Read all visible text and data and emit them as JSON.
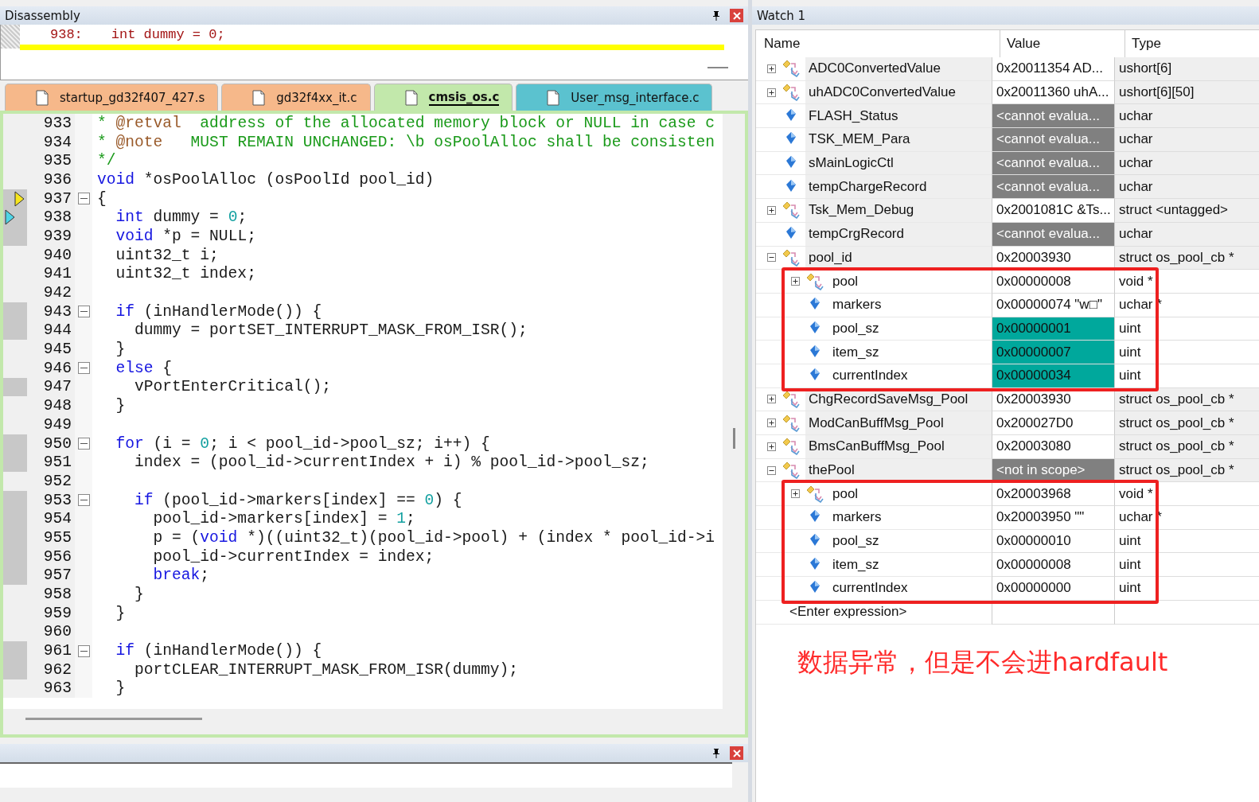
{
  "disassembly": {
    "title": "Disassembly",
    "line_number": "938:",
    "code": "int dummy = 0;"
  },
  "editor": {
    "tabs": [
      {
        "label": "startup_gd32f407_427.s",
        "selected": false,
        "color": "#f6b88a"
      },
      {
        "label": "gd32f4xx_it.c",
        "selected": false,
        "color": "#f6b88a"
      },
      {
        "label": "cmsis_os.c",
        "selected": true,
        "color": "#c2e8ab"
      },
      {
        "label": "User_msg_interface.c",
        "selected": false,
        "color": "#5bc2cf"
      }
    ],
    "lines": [
      {
        "number": "933",
        "kind": "plain",
        "covered": false,
        "foldable": false,
        "segments": [
          {
            "kind": "comment",
            "text": "* "
          },
          {
            "kind": "doc_tag",
            "text": "@retval"
          },
          {
            "kind": "comment",
            "text": "  address of the allocated memory block or NULL in case c"
          }
        ]
      },
      {
        "number": "934",
        "kind": "plain",
        "covered": false,
        "foldable": false,
        "segments": [
          {
            "kind": "comment",
            "text": "* "
          },
          {
            "kind": "doc_tag",
            "text": "@note"
          },
          {
            "kind": "comment",
            "text": "   MUST REMAIN UNCHANGED: \\b osPoolAlloc shall be consisten"
          }
        ]
      },
      {
        "number": "935",
        "kind": "plain",
        "covered": false,
        "foldable": false,
        "segments": [
          {
            "kind": "comment",
            "text": "*/"
          }
        ]
      },
      {
        "number": "936",
        "kind": "plain",
        "covered": false,
        "foldable": false,
        "segments": [
          {
            "kind": "keyword",
            "text": "void"
          },
          {
            "kind": "plain",
            "text": " *osPoolAlloc (osPoolId pool_id)"
          }
        ]
      },
      {
        "number": "937",
        "kind": "current",
        "covered": true,
        "foldable": true,
        "segments": [
          {
            "kind": "plain",
            "text": "{"
          }
        ]
      },
      {
        "number": "938",
        "kind": "caller",
        "covered": true,
        "foldable": false,
        "segments": [
          {
            "kind": "keyword",
            "text": "  int"
          },
          {
            "kind": "plain",
            "text": " dummy = "
          },
          {
            "kind": "number",
            "text": "0"
          },
          {
            "kind": "plain",
            "text": ";"
          }
        ]
      },
      {
        "number": "939",
        "kind": "plain",
        "covered": true,
        "foldable": false,
        "segments": [
          {
            "kind": "keyword",
            "text": "  void"
          },
          {
            "kind": "plain",
            "text": " *p = NULL;"
          }
        ]
      },
      {
        "number": "940",
        "kind": "plain",
        "covered": false,
        "foldable": false,
        "segments": [
          {
            "kind": "plain",
            "text": "  uint32_t i;"
          }
        ]
      },
      {
        "number": "941",
        "kind": "plain",
        "covered": false,
        "foldable": false,
        "segments": [
          {
            "kind": "plain",
            "text": "  uint32_t index;"
          }
        ]
      },
      {
        "number": "942",
        "kind": "plain",
        "covered": false,
        "foldable": false
      },
      {
        "number": "943",
        "kind": "plain",
        "covered": true,
        "foldable": true,
        "segments": [
          {
            "kind": "keyword",
            "text": "  if"
          },
          {
            "kind": "plain",
            "text": " (inHandlerMode()) {"
          }
        ]
      },
      {
        "number": "944",
        "kind": "plain",
        "covered": true,
        "foldable": false,
        "segments": [
          {
            "kind": "plain",
            "text": "    dummy = portSET_INTERRUPT_MASK_FROM_ISR();"
          }
        ]
      },
      {
        "number": "945",
        "kind": "plain",
        "covered": false,
        "foldable": false,
        "segments": [
          {
            "kind": "plain",
            "text": "  }"
          }
        ]
      },
      {
        "number": "946",
        "kind": "plain",
        "covered": false,
        "foldable": true,
        "segments": [
          {
            "kind": "keyword",
            "text": "  else"
          },
          {
            "kind": "plain",
            "text": " {"
          }
        ]
      },
      {
        "number": "947",
        "kind": "plain",
        "covered": true,
        "foldable": false,
        "segments": [
          {
            "kind": "plain",
            "text": "    vPortEnterCritical();"
          }
        ]
      },
      {
        "number": "948",
        "kind": "plain",
        "covered": false,
        "foldable": false,
        "segments": [
          {
            "kind": "plain",
            "text": "  }"
          }
        ]
      },
      {
        "number": "949",
        "kind": "plain",
        "covered": false,
        "foldable": false
      },
      {
        "number": "950",
        "kind": "plain",
        "covered": true,
        "foldable": true,
        "segments": [
          {
            "kind": "keyword",
            "text": "  for"
          },
          {
            "kind": "plain",
            "text": " (i = "
          },
          {
            "kind": "number",
            "text": "0"
          },
          {
            "kind": "plain",
            "text": "; i < pool_id->pool_sz; i++) {"
          }
        ]
      },
      {
        "number": "951",
        "kind": "plain",
        "covered": true,
        "foldable": false,
        "segments": [
          {
            "kind": "plain",
            "text": "    index = (pool_id->currentIndex + i) % pool_id->pool_sz;"
          }
        ]
      },
      {
        "number": "952",
        "kind": "plain",
        "covered": false,
        "foldable": false
      },
      {
        "number": "953",
        "kind": "plain",
        "covered": true,
        "foldable": true,
        "segments": [
          {
            "kind": "keyword",
            "text": "    if"
          },
          {
            "kind": "plain",
            "text": " (pool_id->markers[index] == "
          },
          {
            "kind": "number",
            "text": "0"
          },
          {
            "kind": "plain",
            "text": ") {"
          }
        ]
      },
      {
        "number": "954",
        "kind": "plain",
        "covered": true,
        "foldable": false,
        "segments": [
          {
            "kind": "plain",
            "text": "      pool_id->markers[index] = "
          },
          {
            "kind": "number",
            "text": "1"
          },
          {
            "kind": "plain",
            "text": ";"
          }
        ]
      },
      {
        "number": "955",
        "kind": "plain",
        "covered": true,
        "foldable": false,
        "segments": [
          {
            "kind": "plain",
            "text": "      p = ("
          },
          {
            "kind": "keyword",
            "text": "void"
          },
          {
            "kind": "plain",
            "text": " *)((uint32_t)(pool_id->pool) + (index * pool_id->i"
          }
        ]
      },
      {
        "number": "956",
        "kind": "plain",
        "covered": true,
        "foldable": false,
        "segments": [
          {
            "kind": "plain",
            "text": "      pool_id->currentIndex = index;"
          }
        ]
      },
      {
        "number": "957",
        "kind": "plain",
        "covered": true,
        "foldable": false,
        "segments": [
          {
            "kind": "keyword",
            "text": "      break"
          },
          {
            "kind": "plain",
            "text": ";"
          }
        ]
      },
      {
        "number": "958",
        "kind": "plain",
        "covered": false,
        "foldable": false,
        "segments": [
          {
            "kind": "plain",
            "text": "    }"
          }
        ]
      },
      {
        "number": "959",
        "kind": "plain",
        "covered": false,
        "foldable": false,
        "segments": [
          {
            "kind": "plain",
            "text": "  }"
          }
        ]
      },
      {
        "number": "960",
        "kind": "plain",
        "covered": false,
        "foldable": false
      },
      {
        "number": "961",
        "kind": "plain",
        "covered": true,
        "foldable": true,
        "segments": [
          {
            "kind": "keyword",
            "text": "  if"
          },
          {
            "kind": "plain",
            "text": " (inHandlerMode()) {"
          }
        ]
      },
      {
        "number": "962",
        "kind": "plain",
        "covered": true,
        "foldable": false,
        "segments": [
          {
            "kind": "plain",
            "text": "    portCLEAR_INTERRUPT_MASK_FROM_ISR(dummy);"
          }
        ]
      },
      {
        "number": "963",
        "kind": "plain",
        "covered": false,
        "foldable": false,
        "segments": [
          {
            "kind": "plain",
            "text": "  }"
          }
        ]
      }
    ]
  },
  "watch": {
    "title": "Watch 1",
    "columns": [
      "Name",
      "Value",
      "Type"
    ],
    "rows": [
      {
        "name": "ADC0ConvertedValue",
        "value": "0x20011354 AD...",
        "type": "ushort[6]",
        "kind": "struct",
        "unavailable": false,
        "changed": false,
        "expanded": false,
        "highlighted": false
      },
      {
        "name": "uhADC0ConvertedValue",
        "value": "0x20011360 uhA...",
        "type": "ushort[6][50]",
        "kind": "struct",
        "unavailable": false,
        "changed": false,
        "expanded": false,
        "highlighted": false
      },
      {
        "name": "FLASH_Status",
        "value": "<cannot evalua...",
        "type": "uchar",
        "kind": "scalar",
        "unavailable": true,
        "changed": false,
        "highlighted": false
      },
      {
        "name": "TSK_MEM_Para",
        "value": "<cannot evalua...",
        "type": "uchar",
        "kind": "scalar",
        "unavailable": true,
        "changed": false,
        "highlighted": false
      },
      {
        "name": "sMainLogicCtl",
        "value": "<cannot evalua...",
        "type": "uchar",
        "kind": "scalar",
        "unavailable": true,
        "changed": false,
        "highlighted": false
      },
      {
        "name": "tempChargeRecord",
        "value": "<cannot evalua...",
        "type": "uchar",
        "kind": "scalar",
        "unavailable": true,
        "changed": false,
        "highlighted": false
      },
      {
        "name": "Tsk_Mem_Debug",
        "value": "0x2001081C &Ts...",
        "type": "struct <untagged>",
        "kind": "struct",
        "unavailable": false,
        "changed": false,
        "expanded": false,
        "highlighted": false
      },
      {
        "name": "tempCrgRecord",
        "value": "<cannot evalua...",
        "type": "uchar",
        "kind": "scalar",
        "unavailable": true,
        "changed": false,
        "highlighted": false
      },
      {
        "name": "pool_id",
        "value": "0x20003930",
        "type": "struct os_pool_cb *",
        "kind": "struct",
        "unavailable": false,
        "changed": false,
        "expanded": true,
        "highlighted": true,
        "children": [
          {
            "name": "pool",
            "value": "0x00000008",
            "type": "void *",
            "kind": "struct",
            "unavailable": false,
            "changed": false,
            "expanded": false
          },
          {
            "name": "markers",
            "value": "0x00000074 \"w□\"",
            "type": "uchar *",
            "kind": "scalar",
            "unavailable": false,
            "changed": false
          },
          {
            "name": "pool_sz",
            "value": "0x00000001",
            "type": "uint",
            "kind": "scalar",
            "unavailable": false,
            "changed": true
          },
          {
            "name": "item_sz",
            "value": "0x00000007",
            "type": "uint",
            "kind": "scalar",
            "unavailable": false,
            "changed": true
          },
          {
            "name": "currentIndex",
            "value": "0x00000034",
            "type": "uint",
            "kind": "scalar",
            "unavailable": false,
            "changed": true
          }
        ]
      },
      {
        "name": "ChgRecordSaveMsg_Pool",
        "value": "0x20003930",
        "type": "struct os_pool_cb *",
        "kind": "struct",
        "unavailable": false,
        "changed": false,
        "expanded": false,
        "highlighted": false
      },
      {
        "name": "ModCanBuffMsg_Pool",
        "value": "0x200027D0",
        "type": "struct os_pool_cb *",
        "kind": "struct",
        "unavailable": false,
        "changed": false,
        "expanded": false,
        "highlighted": false
      },
      {
        "name": "BmsCanBuffMsg_Pool",
        "value": "0x20003080",
        "type": "struct os_pool_cb *",
        "kind": "struct",
        "unavailable": false,
        "changed": false,
        "expanded": false,
        "highlighted": false
      },
      {
        "name": "thePool",
        "value": "<not in scope>",
        "type": "struct os_pool_cb *",
        "kind": "struct",
        "unavailable": true,
        "changed": false,
        "expanded": true,
        "highlighted": true,
        "children": [
          {
            "name": "pool",
            "value": "0x20003968",
            "type": "void *",
            "kind": "struct",
            "unavailable": false,
            "changed": false,
            "expanded": false
          },
          {
            "name": "markers",
            "value": "0x20003950 \"\"",
            "type": "uchar *",
            "kind": "scalar",
            "unavailable": false,
            "changed": false
          },
          {
            "name": "pool_sz",
            "value": "0x00000010",
            "type": "uint",
            "kind": "scalar",
            "unavailable": false,
            "changed": false
          },
          {
            "name": "item_sz",
            "value": "0x00000008",
            "type": "uint",
            "kind": "scalar",
            "unavailable": false,
            "changed": false
          },
          {
            "name": "currentIndex",
            "value": "0x00000000",
            "type": "uint",
            "kind": "scalar",
            "unavailable": false,
            "changed": false
          }
        ]
      }
    ],
    "enter_expression": "<Enter expression>"
  },
  "annotation": "数据异常，但是不会进hardfault"
}
